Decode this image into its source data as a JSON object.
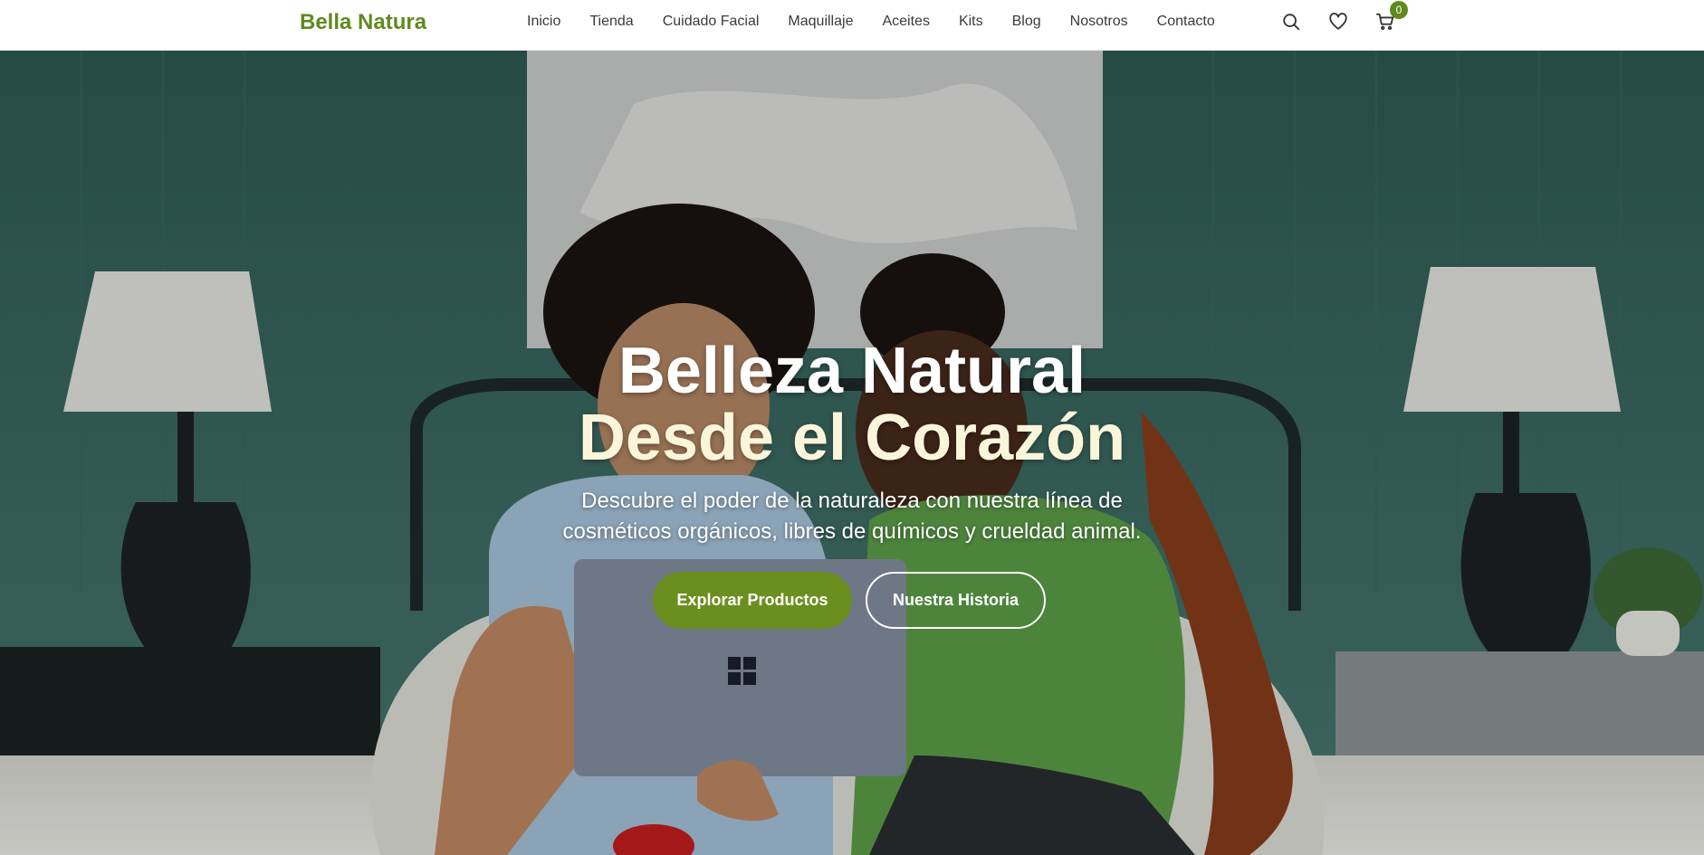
{
  "brand": {
    "name": "Bella Natura",
    "color": "#5f8a1e"
  },
  "nav": {
    "items": [
      {
        "label": "Inicio"
      },
      {
        "label": "Tienda"
      },
      {
        "label": "Cuidado Facial"
      },
      {
        "label": "Maquillaje"
      },
      {
        "label": "Aceites"
      },
      {
        "label": "Kits"
      },
      {
        "label": "Blog"
      },
      {
        "label": "Nosotros"
      },
      {
        "label": "Contacto"
      }
    ]
  },
  "header_icons": {
    "search": "search-icon",
    "wishlist": "heart-icon",
    "cart": "cart-icon",
    "cart_count": "0"
  },
  "hero": {
    "title_line1": "Belleza Natural",
    "title_line2": "Desde el Corazón",
    "subtitle": "Descubre el poder de la naturaleza con nuestra línea de cosméticos orgánicos, libres de químicos y crueldad animal.",
    "primary_button": "Explorar Productos",
    "secondary_button": "Nuestra Historia",
    "colors": {
      "accent": "#6b8f1e",
      "title_line2": "#fbf6da"
    }
  }
}
